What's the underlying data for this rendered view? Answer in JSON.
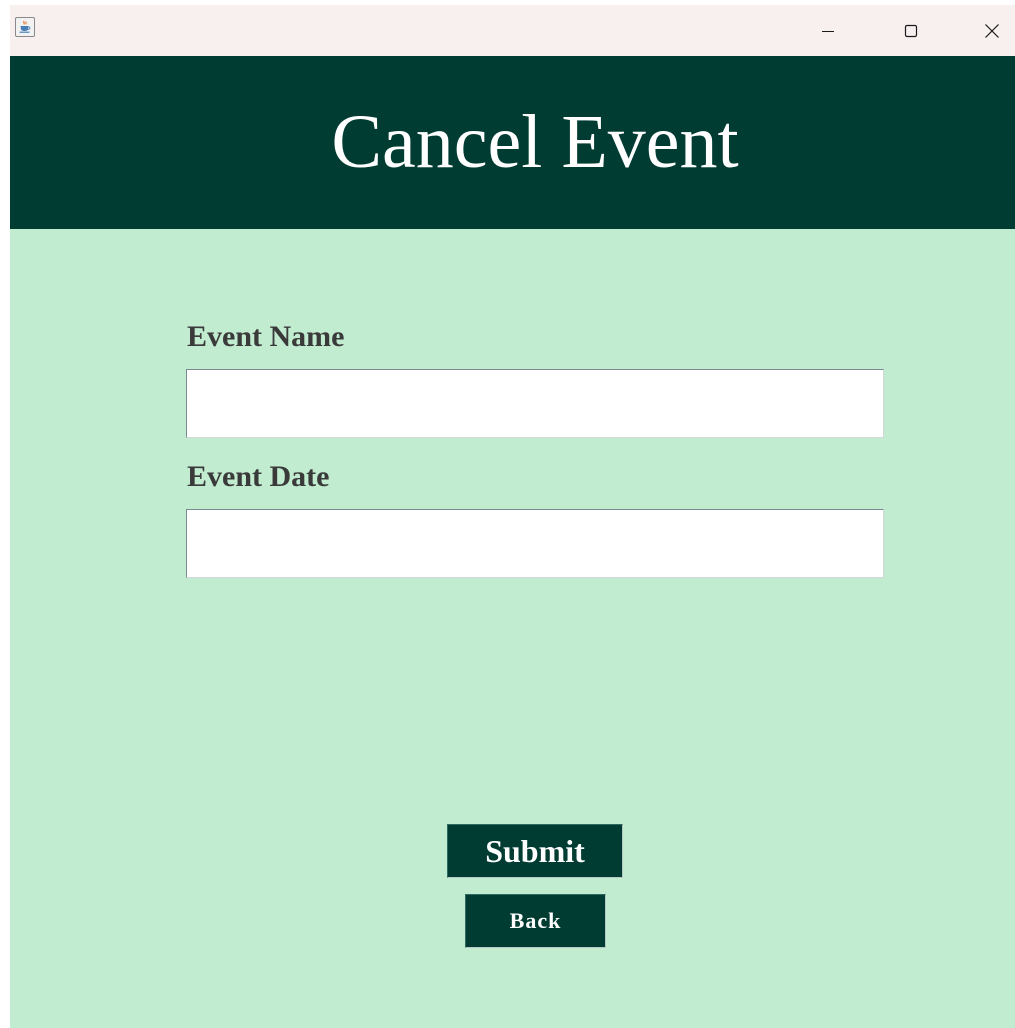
{
  "window": {
    "title": "",
    "app_icon": "java-coffee-cup-icon",
    "controls": {
      "minimize_icon": "minimize-icon",
      "maximize_icon": "maximize-icon",
      "close_icon": "close-icon"
    }
  },
  "header": {
    "title": "Cancel Event"
  },
  "form": {
    "event_name": {
      "label": "Event Name",
      "value": "",
      "placeholder": ""
    },
    "event_date": {
      "label": "Event Date",
      "value": "",
      "placeholder": ""
    }
  },
  "actions": {
    "submit_label": "Submit",
    "back_label": "Back"
  },
  "colors": {
    "titlebar": "#f8efef",
    "header_band": "#013c33",
    "body_background": "#c1ecd0",
    "button_background": "#013c33",
    "button_text": "#ffffff",
    "label_text": "#3a3a3a"
  }
}
